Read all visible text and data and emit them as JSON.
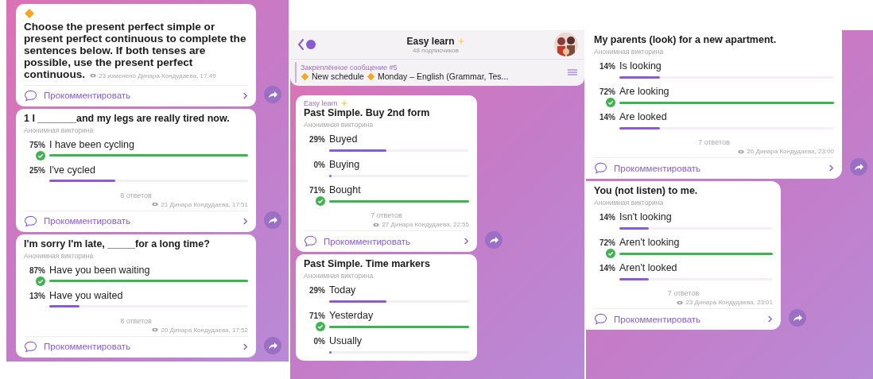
{
  "panels": [
    {
      "messages": [
        {
          "kind": "text",
          "text": "Choose the present perfect simple or present perfect continuous to complete the sentences below. If both tenses are possible, use the present perfect continuous.",
          "meta": "23 изменено Динара Кондудаева, 17:49",
          "comment": "Прокомментировать",
          "share_button": true
        },
        {
          "kind": "poll",
          "question": "1 I _______and my legs are really tired now.",
          "subtitle": "Анонимная викторина",
          "options": [
            {
              "percent": "75%",
              "label": "I have been cycling",
              "level": 1.0,
              "correct": true
            },
            {
              "percent": "25%",
              "label": "I've cycled",
              "level": 0.33,
              "correct": false
            }
          ],
          "total": "8 ответов",
          "meta": "21 Динара Кондудаева, 17:51",
          "comment": "Прокомментировать",
          "share_button": true
        },
        {
          "kind": "poll",
          "question": "I'm sorry I'm late, _____for a long time?",
          "subtitle": "Анонимная викторина",
          "options": [
            {
              "percent": "87%",
              "label": "Have you been waiting",
              "level": 1.0,
              "correct": true
            },
            {
              "percent": "13%",
              "label": "Have you waited",
              "level": 0.15,
              "correct": false
            }
          ],
          "total": "8 ответов",
          "meta": "20 Динара Кондудаева, 17:52",
          "comment": "Прокомментировать",
          "share_button": true
        }
      ]
    },
    {
      "header": {
        "title": "Easy learn",
        "subtitle": "48 подписчиков"
      },
      "pinned": {
        "label": "Закреплённое сообщение #5",
        "parts": [
          "New schedule",
          "Monday – English (Grammar, Tes..."
        ]
      },
      "messages": [
        {
          "kind": "poll",
          "sender": "Easy learn",
          "question": "Past Simple. Buy 2nd form",
          "subtitle": "Анонимная викторина",
          "options": [
            {
              "percent": "29%",
              "label": "Buyed",
              "level": 0.41,
              "correct": false
            },
            {
              "percent": "0%",
              "label": "Buying",
              "level": 0,
              "correct": false
            },
            {
              "percent": "71%",
              "label": "Bought",
              "level": 1.0,
              "correct": true
            }
          ],
          "total": "7 ответов",
          "meta": "27 Динара Кондудаева, 22:55",
          "comment": "Прокомментировать",
          "share_button": true
        },
        {
          "kind": "poll",
          "question": "Past Simple. Time markers",
          "subtitle": "Анонимная викторина",
          "options": [
            {
              "percent": "29%",
              "label": "Today",
              "level": 0.41,
              "correct": false
            },
            {
              "percent": "71%",
              "label": "Yesterday",
              "level": 1.0,
              "correct": true
            },
            {
              "percent": "0%",
              "label": "Usually",
              "level": 0,
              "correct": false
            }
          ],
          "share_button": false
        }
      ]
    },
    {
      "messages": [
        {
          "kind": "poll",
          "question": "My parents (look) for a new apartment.",
          "subtitle": "Анонимная викторина",
          "options": [
            {
              "percent": "14%",
              "label": "Is looking",
              "level": 0.19,
              "correct": false
            },
            {
              "percent": "72%",
              "label": "Are looking",
              "level": 1.0,
              "correct": true
            },
            {
              "percent": "14%",
              "label": "Are looked",
              "level": 0.19,
              "correct": false
            }
          ],
          "total": "7 ответов",
          "meta": "26 Динара Кондудаева, 23:00",
          "comment": "Прокомментировать",
          "share_button": true
        },
        {
          "kind": "poll",
          "question": "You (not listen) to me.",
          "subtitle": "Анонимная викторина",
          "options": [
            {
              "percent": "14%",
              "label": "Isn't looking",
              "level": 0.19,
              "correct": false
            },
            {
              "percent": "72%",
              "label": "Aren't looking",
              "level": 1.0,
              "correct": true
            },
            {
              "percent": "14%",
              "label": "Aren't looked",
              "level": 0.19,
              "correct": false
            }
          ],
          "total": "7 ответов",
          "meta": "23 Динара Кондудаева, 23:01",
          "comment": "Прокомментировать",
          "share_button": true
        }
      ]
    }
  ]
}
